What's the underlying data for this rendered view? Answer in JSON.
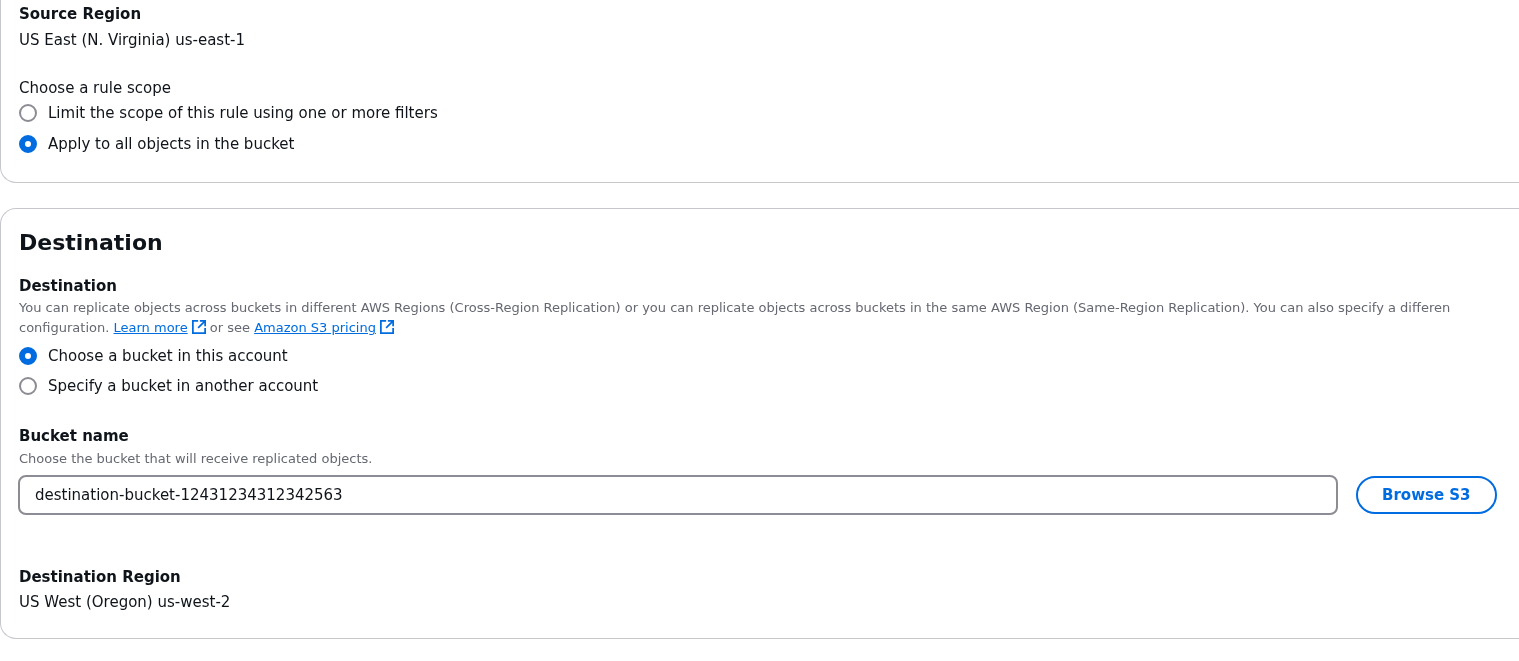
{
  "source_region": {
    "label": "Source Region",
    "value": "US East (N. Virginia) us-east-1"
  },
  "rule_scope": {
    "label": "Choose a rule scope",
    "options": [
      {
        "label": "Limit the scope of this rule using one or more filters",
        "selected": false
      },
      {
        "label": "Apply to all objects in the bucket",
        "selected": true
      }
    ]
  },
  "destination": {
    "title": "Destination",
    "destination_field": {
      "label": "Destination",
      "description": [
        [
          {
            "kind": "text",
            "text": "You can replicate objects across buckets in different AWS Regions (Cross-Region Replication) or you can replicate objects across buckets in the same AWS Region (Same-Region Replication). You can also specify a differen"
          }
        ],
        [
          {
            "kind": "text",
            "text": "configuration."
          },
          {
            "kind": "external_link",
            "text": "Learn more"
          },
          {
            "kind": "text",
            "text": "or see"
          },
          {
            "kind": "external_link",
            "text": "Amazon S3 pricing"
          }
        ]
      ],
      "options": [
        {
          "label": "Choose a bucket in this account",
          "selected": true
        },
        {
          "label": "Specify a bucket in another account",
          "selected": false
        }
      ]
    },
    "bucket_name": {
      "label": "Bucket name",
      "hint": "Choose the bucket that will receive replicated objects.",
      "value": "destination-bucket-12431234312342563",
      "button": "Browse S3"
    },
    "destination_region": {
      "label": "Destination Region",
      "value": "US West (Oregon) us-west-2"
    }
  }
}
